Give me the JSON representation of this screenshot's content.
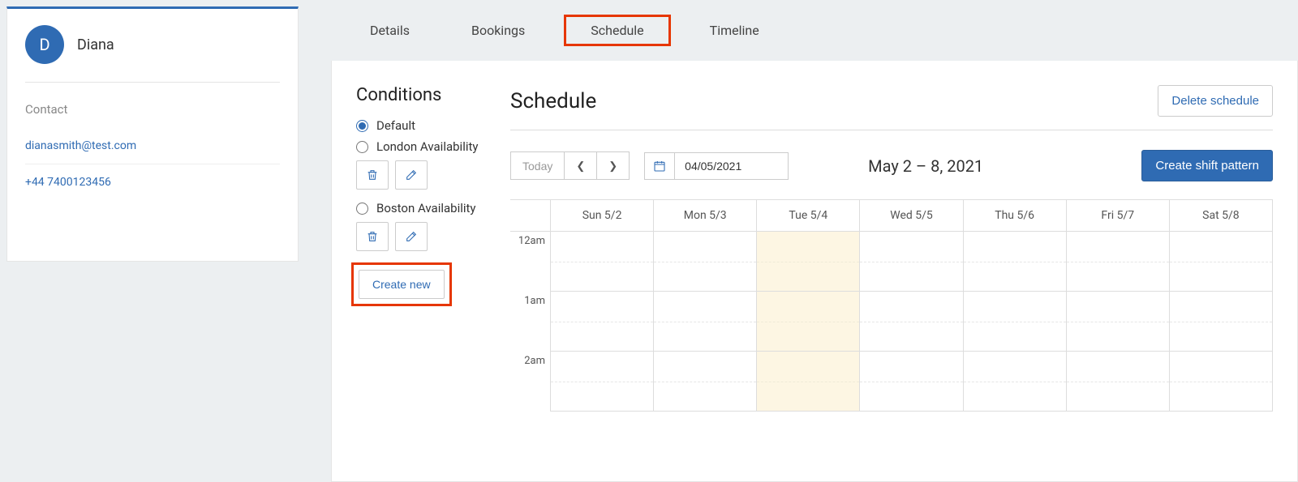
{
  "profile": {
    "initial": "D",
    "name": "Diana"
  },
  "contact": {
    "heading": "Contact",
    "email": "dianasmith@test.com",
    "phone": "+44 7400123456"
  },
  "tabs": {
    "details": "Details",
    "bookings": "Bookings",
    "schedule": "Schedule",
    "timeline": "Timeline",
    "active": "schedule"
  },
  "conditions": {
    "heading": "Conditions",
    "options": [
      {
        "label": "Default",
        "selected": true,
        "deletable": false
      },
      {
        "label": "London Availability",
        "selected": false,
        "deletable": true
      },
      {
        "label": "Boston Availability",
        "selected": false,
        "deletable": true
      }
    ],
    "create_new": "Create new"
  },
  "schedule": {
    "heading": "Schedule",
    "delete_label": "Delete schedule",
    "today_label": "Today",
    "date_value": "04/05/2021",
    "range_label": "May 2 – 8, 2021",
    "create_shift_label": "Create shift pattern",
    "days": [
      "Sun 5/2",
      "Mon 5/3",
      "Tue 5/4",
      "Wed 5/5",
      "Thu 5/6",
      "Fri 5/7",
      "Sat 5/8"
    ],
    "highlighted_day_index": 2,
    "times": [
      "12am",
      "1am",
      "2am"
    ]
  }
}
